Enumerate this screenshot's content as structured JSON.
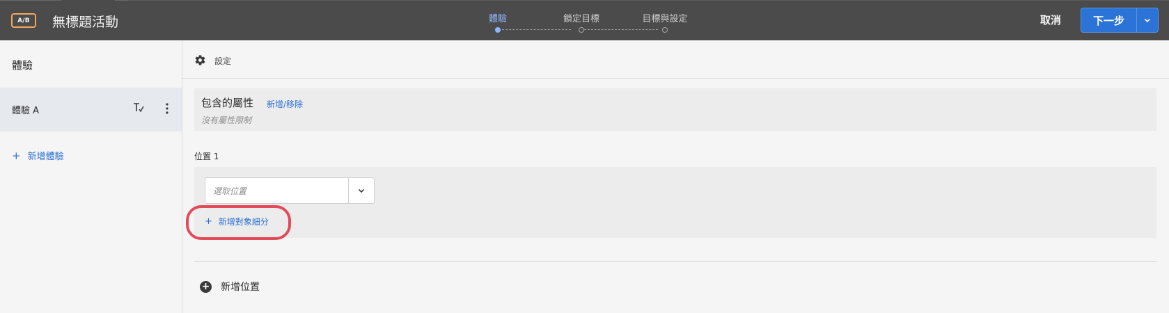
{
  "header": {
    "badge": "A/B",
    "title": "無標題活動",
    "steps": [
      {
        "label": "體驗",
        "active": true
      },
      {
        "label": "鎖定目標",
        "active": false
      },
      {
        "label": "目標與設定",
        "active": false
      }
    ],
    "cancel_label": "取消",
    "next_label": "下一步"
  },
  "sidebar": {
    "title": "體驗",
    "items": [
      {
        "label": "體驗 A"
      }
    ],
    "add_label": "新增體驗"
  },
  "main": {
    "settings_label": "設定",
    "attributes": {
      "title": "包含的屬性",
      "link": "新增/移除",
      "note": "沒有屬性限制"
    },
    "location": {
      "title": "位置 1",
      "placeholder": "選取位置",
      "add_segment": "新增對象細分"
    },
    "add_location": "新增位置"
  },
  "colors": {
    "accent": "#2b73d6",
    "topbar": "#4b4b4b",
    "badge_border": "#f5a75f",
    "highlight": "#e14b5a"
  }
}
